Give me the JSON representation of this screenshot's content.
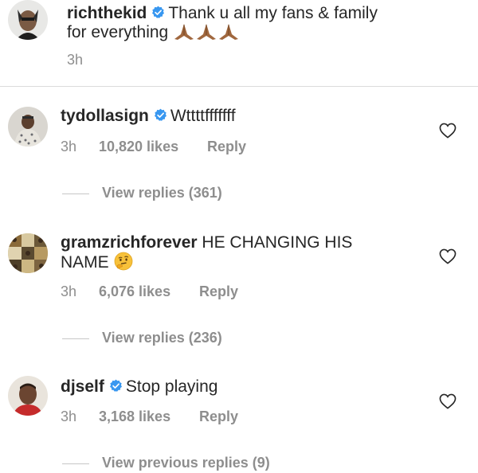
{
  "post": {
    "username": "richthekid",
    "text_line1": "Thank u all my fans & family",
    "text_line2": "for everything",
    "emoji_icon": "folded-hands-emoji",
    "time": "3h"
  },
  "comments": [
    {
      "username": "tydollasign",
      "verified": true,
      "text": "Wttttfffffff",
      "time": "3h",
      "likes": "10,820 likes",
      "reply_label": "Reply",
      "replies_label": "View replies (361)"
    },
    {
      "username": "gramzrichforever",
      "verified": false,
      "text_line1": "HE CHANGING HIS",
      "text_line2": "NAME",
      "emoji_icon": "thinking-face-emoji",
      "time": "3h",
      "likes": "6,076 likes",
      "reply_label": "Reply",
      "replies_label": "View replies (236)"
    },
    {
      "username": "djself",
      "verified": true,
      "text": "Stop playing",
      "time": "3h",
      "likes": "3,168 likes",
      "reply_label": "Reply",
      "replies_label": "View previous replies (9)"
    }
  ],
  "colors": {
    "text": "#262626",
    "secondary": "#8e8e8e",
    "verified_blue": "#3897f0",
    "divider": "#dbdbdb"
  }
}
